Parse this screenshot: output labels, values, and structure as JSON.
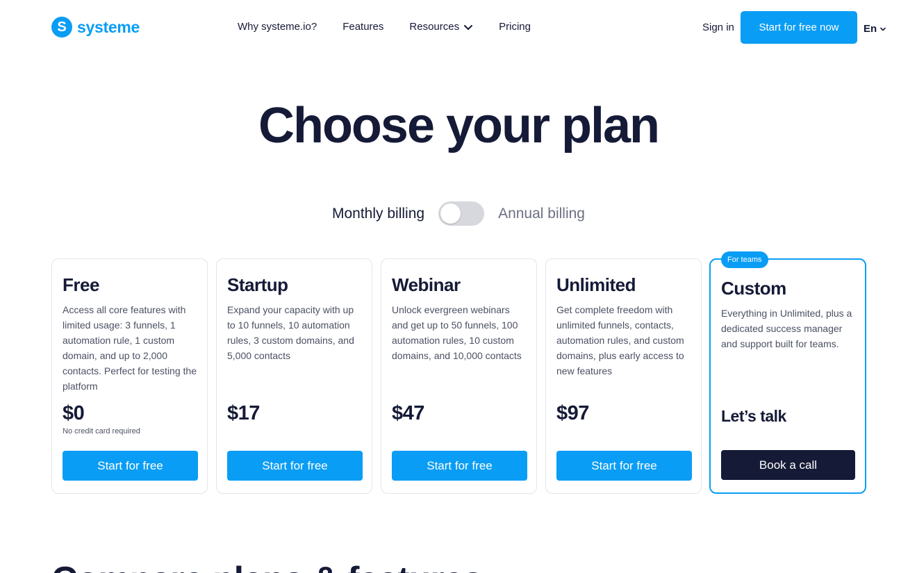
{
  "header": {
    "logo_mark": "S",
    "logo_text": "systeme",
    "nav": [
      {
        "label": "Why systeme.io?"
      },
      {
        "label": "Features"
      },
      {
        "label": "Resources"
      },
      {
        "label": "Pricing"
      }
    ],
    "signin": "Sign in",
    "cta": "Start for free now",
    "language": "En"
  },
  "hero": {
    "title": "Choose your plan"
  },
  "billing": {
    "monthly": "Monthly billing",
    "annual": "Annual billing",
    "annual_selected": false
  },
  "plans": [
    {
      "name": "Free",
      "description": "Access all core features with limited usage: 3 funnels, 1 automation rule, 1 custom domain, and up to 2,000 contacts. Perfect for testing the platform",
      "price": "$0",
      "note": "No credit card required",
      "button": "Start for free"
    },
    {
      "name": "Startup",
      "description": "Expand your capacity with up to 10 funnels, 10 automation rules, 3 custom domains, and 5,000 contacts",
      "price": "$17",
      "button": "Start for free"
    },
    {
      "name": "Webinar",
      "description": "Unlock evergreen webinars and get up to 50 funnels, 100 automation rules, 10 custom domains, and 10,000 contacts",
      "price": "$47",
      "button": "Start for free"
    },
    {
      "name": "Unlimited",
      "description": "Get complete freedom with unlimited funnels, contacts, automation rules, and custom domains, plus early access to new features",
      "price": "$97",
      "button": "Start for free"
    },
    {
      "badge": "For teams",
      "name": "Custom",
      "description": "Everything in Unlimited, plus a dedicated success manager and support built for teams.",
      "price": "Let’s talk",
      "button": "Book a call"
    }
  ],
  "next_section": {
    "heading": "Compare plans & features"
  },
  "colors": {
    "accent": "#0a9df5",
    "dark": "#151a37",
    "toggle_off": "#d6d8dd"
  }
}
